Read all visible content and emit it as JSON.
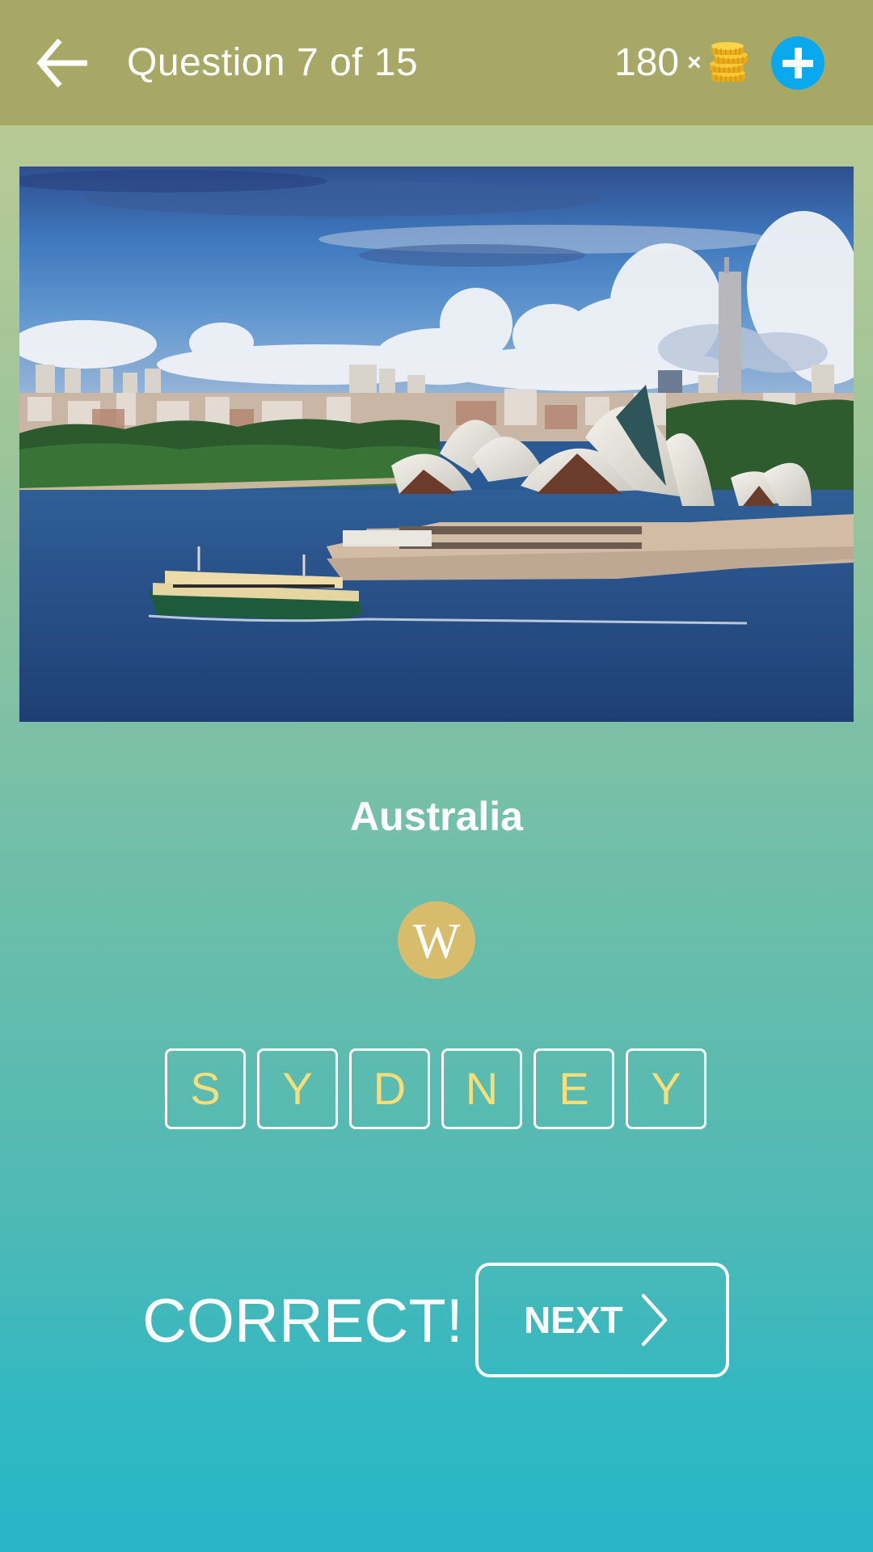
{
  "header": {
    "title": "Question 7 of 15",
    "coin_count": "180",
    "times_symbol": "×",
    "back_icon": "arrow-left-icon",
    "coin_icon": "coin-stack-icon",
    "add_icon": "plus-icon"
  },
  "question": {
    "image_description": "Sydney Opera House and harbour with a ferry",
    "country": "Australia",
    "wiki_letter": "W"
  },
  "answer": {
    "letters": [
      "S",
      "Y",
      "D",
      "N",
      "E",
      "Y"
    ]
  },
  "result": {
    "status": "CORRECT!",
    "next_label": "NEXT",
    "next_icon": "chevron-right-icon"
  },
  "colors": {
    "header_bg": "#a8a866",
    "add_button": "#0aa8ec",
    "wiki_button": "#d7bc6b",
    "letter_color": "#f6de7a",
    "bg_top": "#bccb96",
    "bg_bottom": "#28b6c8"
  }
}
